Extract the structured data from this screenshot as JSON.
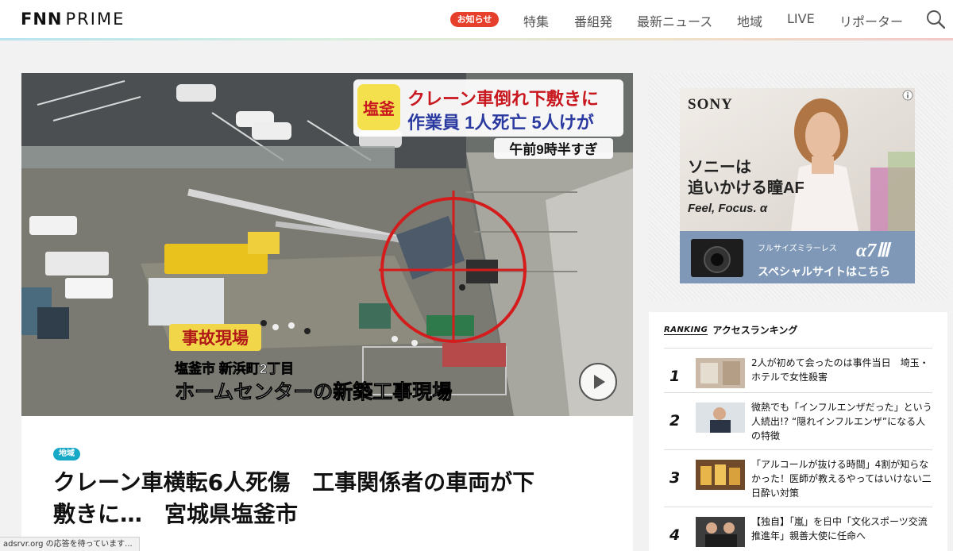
{
  "header": {
    "logo_main": "FNN",
    "logo_sub": "PRIME",
    "notice_badge": "お知らせ",
    "nav": [
      "特集",
      "番組発",
      "最新ニュース",
      "地域",
      "LIVE",
      "リポーター"
    ]
  },
  "hero": {
    "caption_region": "塩釜",
    "caption_line1": "クレーン車倒れ下敷きに",
    "caption_line2": "作業員 1人死亡 5人けが",
    "caption_time": "午前9時半すぎ",
    "caption_scene": "事故現場",
    "caption_addr": "塩釜市 新浜町2丁目",
    "caption_site": "ホームセンターの新築工事現場"
  },
  "article": {
    "tag": "地域",
    "headline_1": "クレーン車横転6人死傷　工事関係者の車両が下",
    "headline_2": "敷きに…　宮城県塩釜市"
  },
  "ad": {
    "brand": "SONY",
    "copy_1": "ソニーは",
    "copy_2": "追いかける瞳AF",
    "copy_3": "Feel, Focus. α",
    "product_label": "フルサイズミラーレス",
    "product_name": "α7Ⅲ",
    "cta": "スペシャルサイトはこちら"
  },
  "ranking": {
    "label_en": "RANKING",
    "label_ja": "アクセスランキング",
    "items": [
      {
        "rank": "1",
        "title": "2人が初めて会ったのは事件当日　埼玉・ホテルで女性殺害"
      },
      {
        "rank": "2",
        "title": "微熱でも「インフルエンザだった」という人続出!? “隠れインフルエンザ”になる人の特徴"
      },
      {
        "rank": "3",
        "title": "「アルコールが抜ける時間」4割が知らなかった！医師が教えるやってはいけない二日酔い対策"
      },
      {
        "rank": "4",
        "title": "【独自】「嵐」を日中「文化スポーツ交流推進年」親善大使に任命へ"
      }
    ]
  },
  "status_bar": "adsrvr.org の応答を待っています..."
}
